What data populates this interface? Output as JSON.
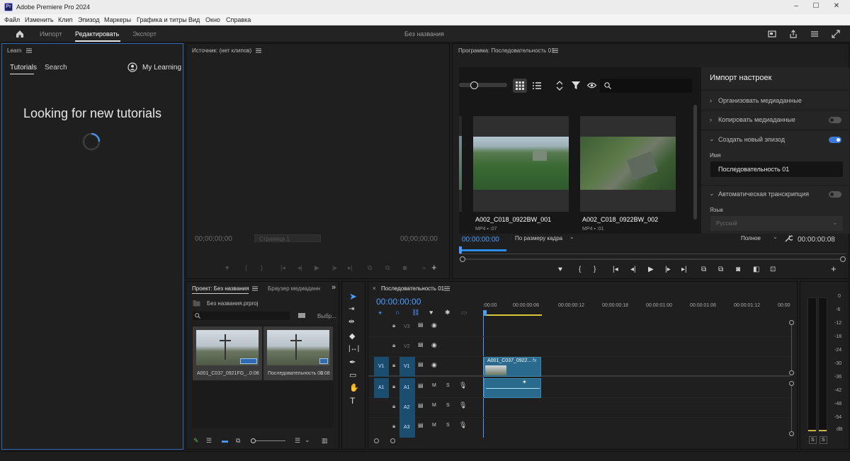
{
  "window": {
    "title": "Adobe Premiere Pro 2024",
    "app_badge": "Pr",
    "minimize": "–",
    "maximize": "☐",
    "close": "✕"
  },
  "menu": {
    "items": [
      "Файл",
      "Изменить",
      "Клип",
      "Эпизод",
      "Маркеры",
      "Графика и титры",
      "Вид",
      "Окно",
      "Справка"
    ]
  },
  "header": {
    "tabs": [
      "Импорт",
      "Редактировать",
      "Экспорт"
    ],
    "active_tab": "Редактировать",
    "project_title": "Без названия"
  },
  "learn": {
    "panel_title": "Learn",
    "tab_tutorials": "Tutorials",
    "tab_search": "Search",
    "my_learning": "My Learning",
    "loading_text": "Looking for new tutorials"
  },
  "source": {
    "panel_title": "Источник: (нет клипов)",
    "timecode_left": "00;00;00;00",
    "page_label": "Страница 1",
    "timecode_right": "00;00;00;00"
  },
  "program": {
    "panel_title": "Программа: Последовательность 01",
    "clips": [
      {
        "name": "A002_C018_0922BW_001",
        "meta": "MP4 ▪ :07"
      },
      {
        "name": "A002_C018_0922BW_002",
        "meta": "MP4 ▪ :01"
      }
    ],
    "timecode_left": "00:00:00:00",
    "fit_label": "По размеру кадра",
    "quality_label": "Полное",
    "timecode_right": "00:00:00:08"
  },
  "import_settings": {
    "title": "Импорт настроек",
    "rows": [
      {
        "label": "Организовать медиаданные"
      },
      {
        "label": "Копировать медиаданные"
      },
      {
        "label": "Создать новый эпизод"
      },
      {
        "label": "Автоматическая транскрипция"
      }
    ],
    "name_label": "Имя",
    "name_value": "Последовательность 01",
    "lang_label": "Язык",
    "lang_value": "Русский",
    "copy_on": false,
    "new_sequence_on": true,
    "transcribe_on": false
  },
  "project": {
    "tab_project": "Проект: Без названия",
    "tab_browser": "Браузер медиаданн",
    "file_name": "Без названия.prproj",
    "select_label": "Выбр...",
    "items": [
      {
        "name": "A001_C037_0921FG_...",
        "duration": "0:08"
      },
      {
        "name": "Последовательность 01",
        "duration": "0:08"
      }
    ]
  },
  "timeline": {
    "tab_label": "Последовательность 01",
    "timecode": "00:00:00:00",
    "ruler": [
      ":00:00",
      "00:00:00:06",
      "00:00:00:12",
      "00:00:00:18",
      "00:00:01:00",
      "00:00:01:06",
      "00:00:01:12",
      "00:00"
    ],
    "video_tracks": [
      "V3",
      "V2",
      "V1"
    ],
    "audio_tracks": [
      "A1",
      "A2",
      "A3"
    ],
    "source_patch_v": "V1",
    "source_patch_a": "A1",
    "clip_name": "A001_C037_0922...",
    "mute_label": "M",
    "solo_label": "S",
    "fx_label": "fx"
  },
  "meter": {
    "scale": [
      "0",
      "-6",
      "-12",
      "-18",
      "-24",
      "-30",
      "-36",
      "-42",
      "-48",
      "-54",
      "dB"
    ],
    "solo_left": "S",
    "solo_right": "S"
  },
  "colors": {
    "accent": "#2d8ceb",
    "track_blue": "#1a4d6e",
    "clip_blue": "#2a6a8c",
    "bg": "#1d1d1d"
  }
}
